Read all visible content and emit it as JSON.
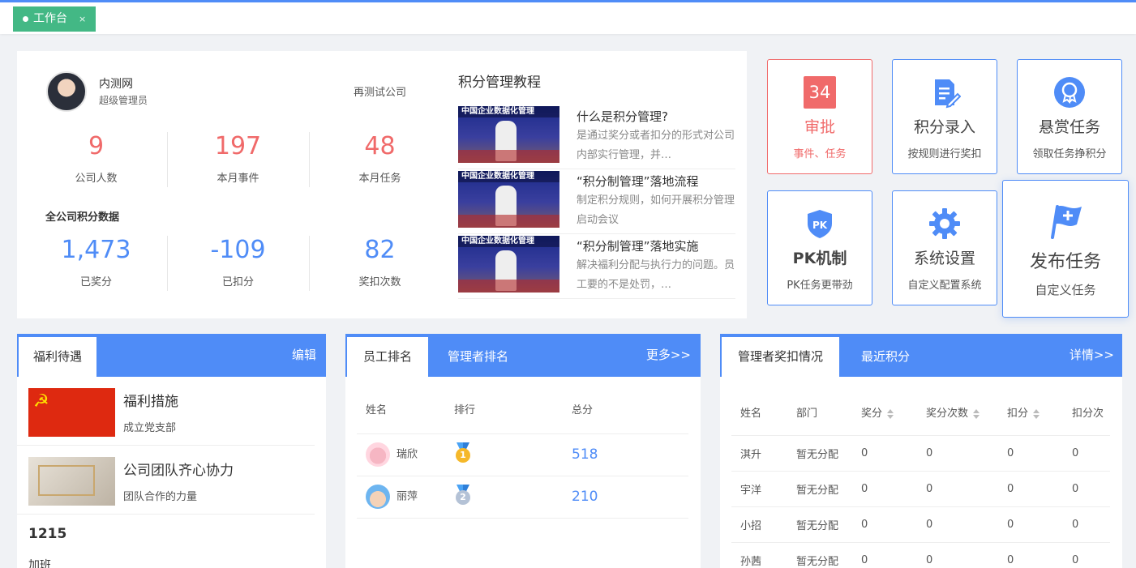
{
  "tabbar": {
    "tab_label": "工作台",
    "close_label": "×"
  },
  "profile": {
    "name": "内测网",
    "role": "超级管理员",
    "company": "再测试公司",
    "stats_top": [
      {
        "value": "9",
        "label": "公司人数"
      },
      {
        "value": "197",
        "label": "本月事件"
      },
      {
        "value": "48",
        "label": "本月任务"
      }
    ],
    "section_label": "全公司积分数据",
    "stats_bottom": [
      {
        "value": "1,473",
        "label": "已奖分"
      },
      {
        "value": "-109",
        "label": "已扣分"
      },
      {
        "value": "82",
        "label": "奖扣次数"
      }
    ]
  },
  "tutorial": {
    "title": "积分管理教程",
    "thumb_caption": "中国企业数据化管理",
    "items": [
      {
        "title": "什么是积分管理?",
        "desc": "是通过奖分或者扣分的形式对公司内部实行管理，并…"
      },
      {
        "title": "“积分制管理”落地流程",
        "desc": "制定积分规则，如何开展积分管理启动会议"
      },
      {
        "title": "“积分制管理”落地实施",
        "desc": "解决福利分配与执行力的问题。员工要的不是处罚，…"
      }
    ]
  },
  "tiles": {
    "approve": {
      "badge": "34",
      "title": "审批",
      "sub": "事件、任务"
    },
    "score_entry": {
      "title": "积分录入",
      "sub": "按规则进行奖扣",
      "icon": "document-edit-icon"
    },
    "bounty": {
      "title": "悬赏任务",
      "sub": "领取任务挣积分",
      "icon": "award-icon"
    },
    "pk": {
      "title": "PK机制",
      "sub": "PK任务更带劲",
      "icon": "pk-shield-icon"
    },
    "settings": {
      "title": "系统设置",
      "sub": "自定义配置系统",
      "icon": "gear-icon"
    },
    "publish": {
      "title": "发布任务",
      "sub": "自定义任务",
      "icon": "flag-plus-icon"
    }
  },
  "welfare": {
    "tab_label": "福利待遇",
    "edit_label": "编辑",
    "items": [
      {
        "title": "福利措施",
        "sub": "成立党支部"
      },
      {
        "title": "公司团队齐心协力",
        "sub": "团队合作的力量"
      }
    ],
    "extra_title": "1215",
    "extra_sub": "加班"
  },
  "ranking": {
    "tab_employee": "员工排名",
    "tab_manager": "管理者排名",
    "more_label": "更多>>",
    "columns": [
      "姓名",
      "排行",
      "总分"
    ],
    "rows": [
      {
        "name": "瑞欣",
        "rank": "1",
        "score": "518"
      },
      {
        "name": "丽萍",
        "rank": "2",
        "score": "210"
      }
    ]
  },
  "manager_scores": {
    "tab_active": "管理者奖扣情况",
    "tab_other": "最近积分",
    "detail_label": "详情>>",
    "columns": [
      "姓名",
      "部门",
      "奖分",
      "奖分次数",
      "扣分",
      "扣分次"
    ],
    "rows": [
      {
        "name": "淇升",
        "dept": "暂无分配",
        "award": "0",
        "award_count": "0",
        "deduct": "0",
        "deduct_count": "0"
      },
      {
        "name": "宇洋",
        "dept": "暂无分配",
        "award": "0",
        "award_count": "0",
        "deduct": "0",
        "deduct_count": "0"
      },
      {
        "name": "小招",
        "dept": "暂无分配",
        "award": "0",
        "award_count": "0",
        "deduct": "0",
        "deduct_count": "0"
      },
      {
        "name": "孙茜",
        "dept": "暂无分配",
        "award": "0",
        "award_count": "0",
        "deduct": "0",
        "deduct_count": "0"
      }
    ]
  },
  "colors": {
    "primary": "#4f8cf7",
    "accent_red": "#f06a6a",
    "tab_green": "#43b885"
  }
}
